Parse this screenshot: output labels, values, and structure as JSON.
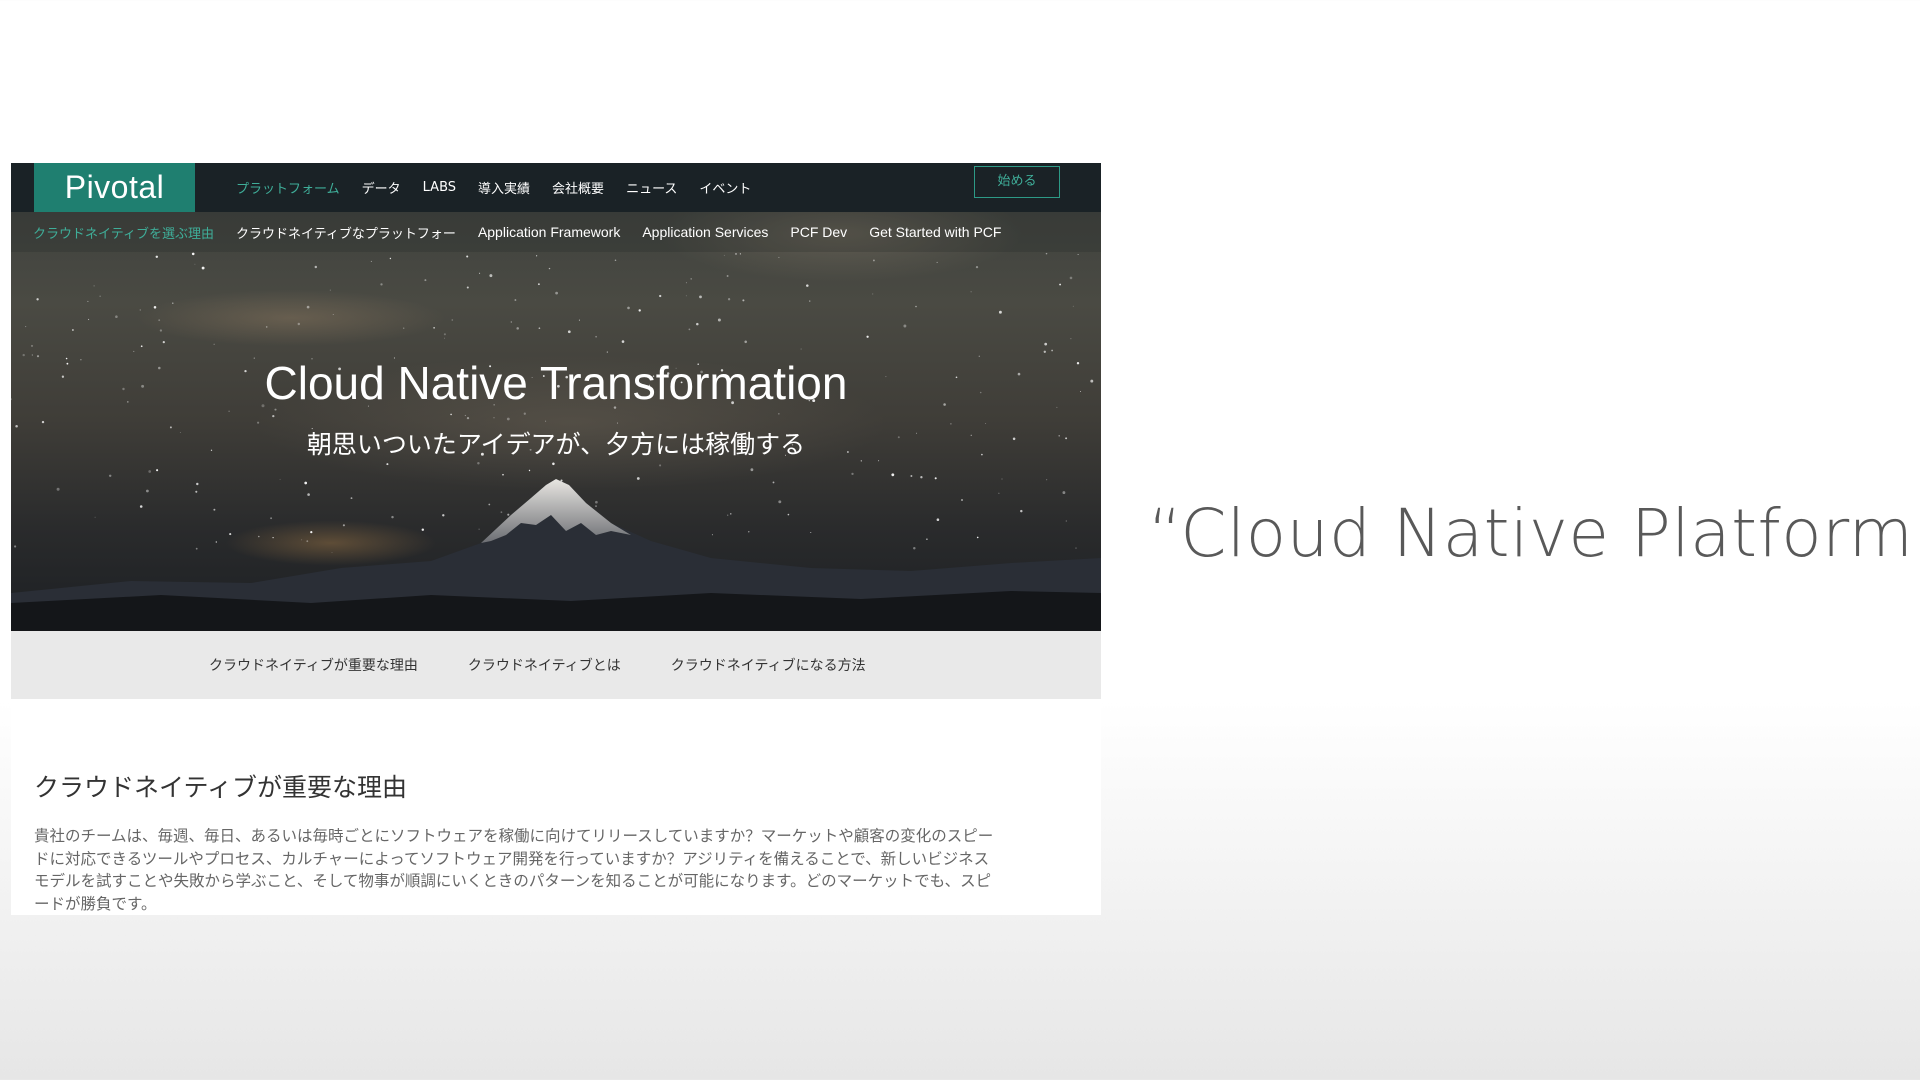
{
  "webpage": {
    "logo": "Pivotal",
    "top_nav": [
      "プラットフォーム",
      "データ",
      "LABS",
      "導入実績",
      "会社概要",
      "ニュース",
      "イベント"
    ],
    "start_button": "始める",
    "sub_nav": [
      "クラウドネイティブを選ぶ理由",
      "クラウドネイティブなプラットフォー",
      "Application Framework",
      "Application Services",
      "PCF Dev",
      "Get Started with PCF"
    ],
    "hero": {
      "title": "Cloud Native Transformation",
      "subtitle": "朝思いついたアイデアが、夕方には稼働する"
    },
    "tabs": [
      "クラウドネイティブが重要な理由",
      "クラウドネイティブとは",
      "クラウドネイティブになる方法"
    ],
    "content": {
      "heading": "クラウドネイティブが重要な理由",
      "body": "貴社のチームは、毎週、毎日、あるいは毎時ごとにソフトウェアを稼働に向けてリリースしていますか？マーケットや顧客の変化のスピードに対応できるツールやプロセス、カルチャーによってソフトウェア開発を行っていますか？アジリティを備えることで、新しいビジネスモデルを試すことや失敗から学ぶこと、そして物事が順調にいくときのパターンを知ることが可能になります。どのマーケットでも、スピードが勝負です。"
    }
  },
  "slide": {
    "quote": "“Cloud Native Platform”"
  },
  "colors": {
    "nav_bg": "#1a2226",
    "brand_teal": "#1f7f70",
    "accent_teal": "#3fae99",
    "tabs_bg": "#e9e9e9",
    "quote_text": "#595959"
  }
}
